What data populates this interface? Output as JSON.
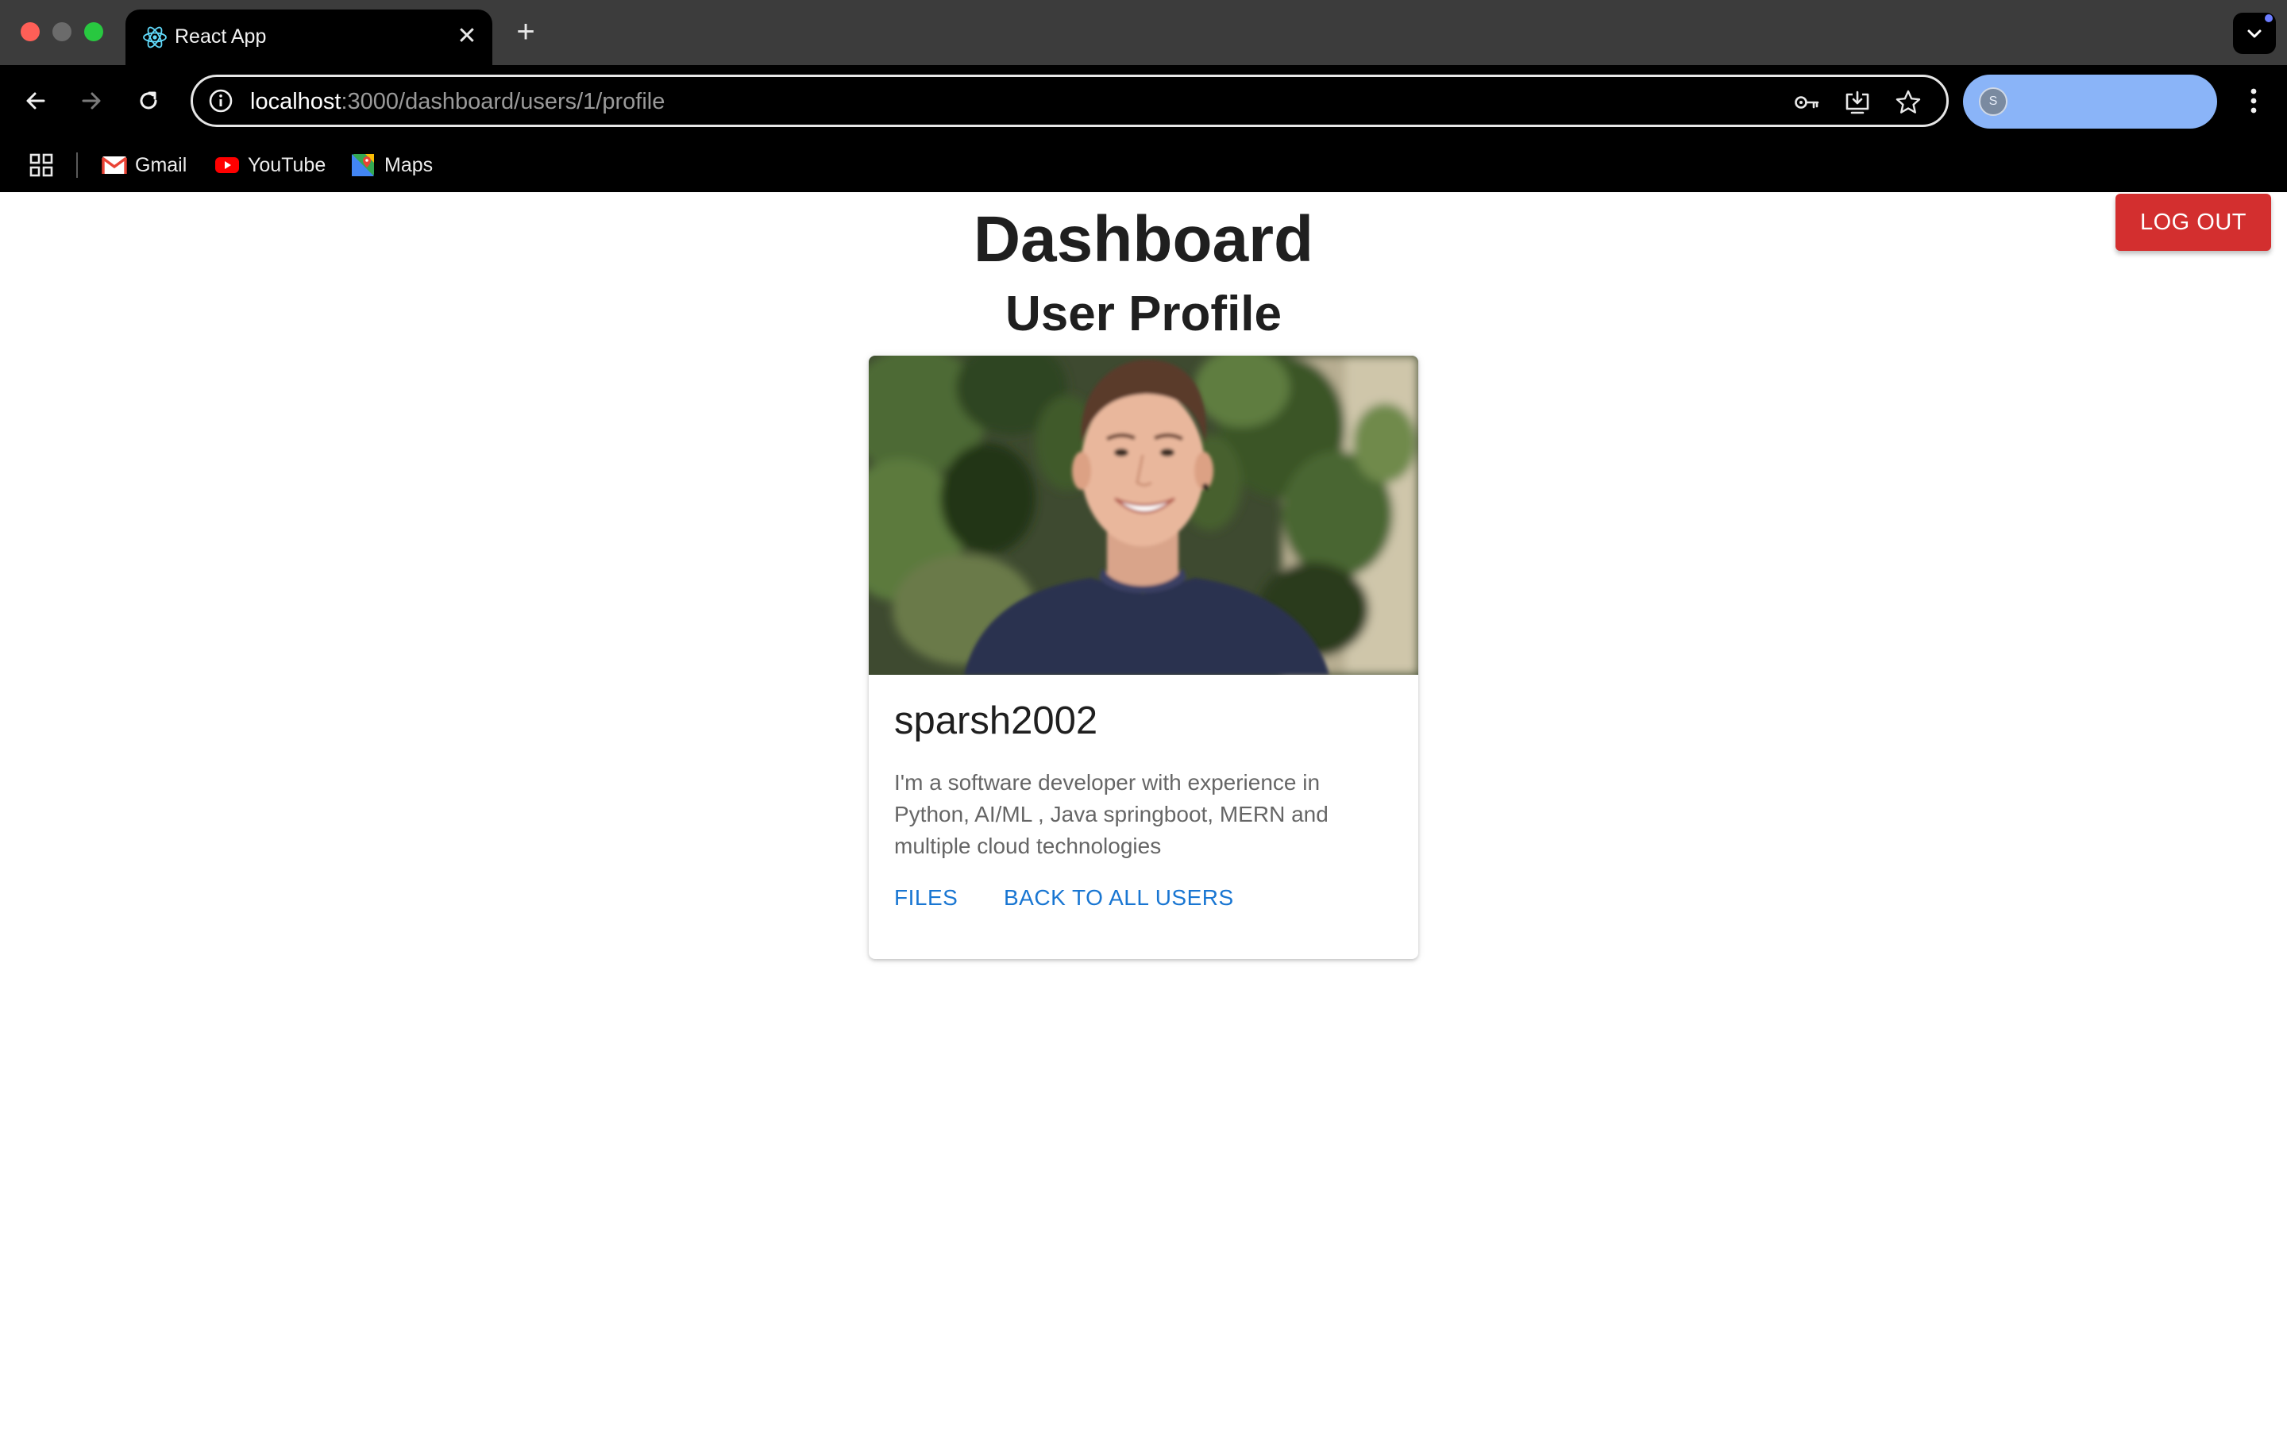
{
  "browser": {
    "tab_title": "React App",
    "url_host": "localhost",
    "url_path": ":3000/dashboard/users/1/profile",
    "profile_initial": "S",
    "bookmarks": [
      {
        "label": "Gmail",
        "icon": "gmail-icon"
      },
      {
        "label": "YouTube",
        "icon": "youtube-icon"
      },
      {
        "label": "Maps",
        "icon": "maps-icon"
      }
    ]
  },
  "page": {
    "logout_label": "LOG OUT",
    "title": "Dashboard",
    "subtitle": "User Profile"
  },
  "profile": {
    "username": "sparsh2002",
    "bio": "I'm a software developer with experience in Python, AI/ML , Java springboot, MERN and multiple cloud technologies",
    "actions": {
      "files": "FILES",
      "back": "BACK TO ALL USERS"
    }
  },
  "colors": {
    "logout": "#d32f2f",
    "link": "#1976d2",
    "profile_pill": "#8ab4f8"
  }
}
